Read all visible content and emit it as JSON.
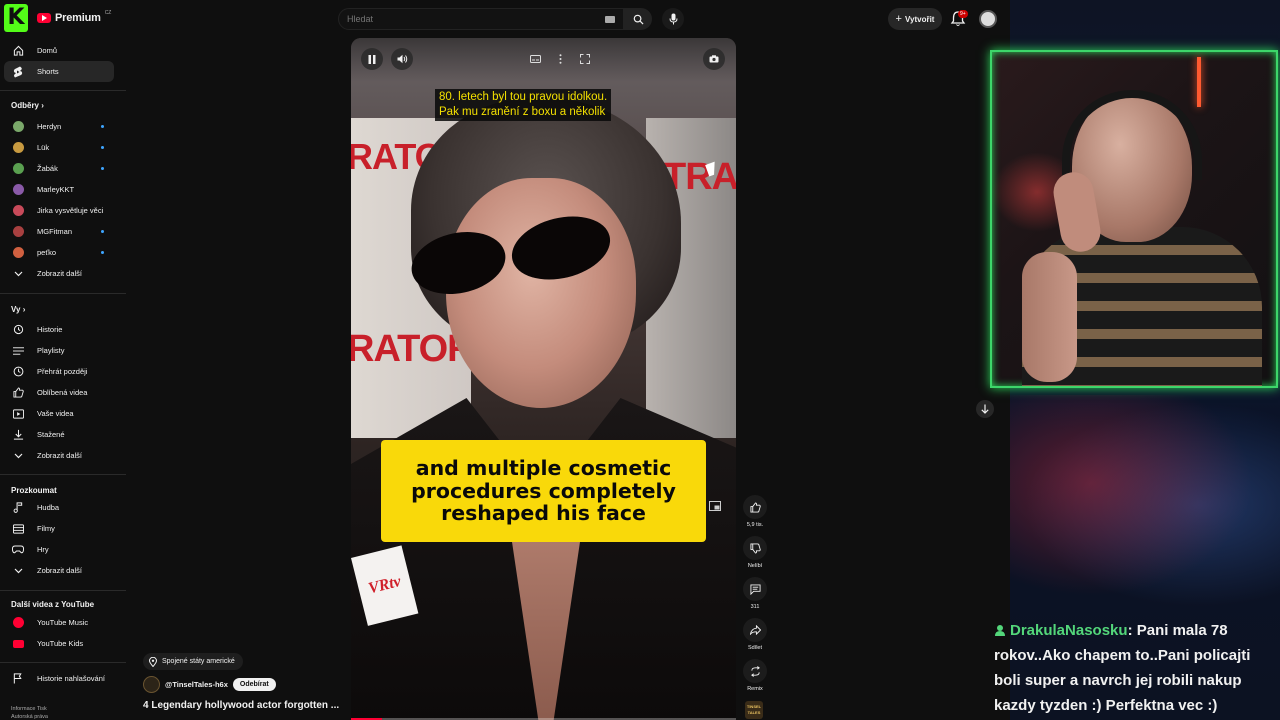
{
  "header": {
    "brand": "Premium",
    "brand_superscript": "CZ",
    "search_placeholder": "Hledat",
    "create_label": "Vytvořit",
    "notification_badge": "9+"
  },
  "sidebar": {
    "home": "Domů",
    "shorts": "Shorts",
    "subscriptions_heading": "Odběry",
    "channels": [
      {
        "name": "Herdyn",
        "color": "#7aa86a"
      },
      {
        "name": "Lük",
        "color": "#c89a40"
      },
      {
        "name": "Žabák",
        "color": "#5aa050"
      },
      {
        "name": "MarleyKKT",
        "color": "#8a5aa8"
      },
      {
        "name": "Jirka vysvětluje věci",
        "color": "#c84a5a"
      },
      {
        "name": "MGFitman",
        "color": "#a84040"
      },
      {
        "name": "peťko",
        "color": "#d06040"
      }
    ],
    "show_more_subs": "Zobrazit další",
    "you_heading": "Vy",
    "you_items": [
      "Historie",
      "Playlisty",
      "Přehrát později",
      "Oblíbená videa",
      "Vaše videa",
      "Stažené",
      "Zobrazit další"
    ],
    "explore_heading": "Prozkoumat",
    "explore_items": [
      "Hudba",
      "Filmy",
      "Hry",
      "Zobrazit další"
    ],
    "more_heading": "Další videa z YouTube",
    "more_items": [
      "YouTube Music",
      "YouTube Kids"
    ],
    "report_history": "Historie nahlašování",
    "footer_1": "Informace  Tisk",
    "footer_2": "Autorská práva"
  },
  "video": {
    "subtitle_line_1": "80. letech byl tou pravou idolkou.",
    "subtitle_line_2": "Pak mu zranění z boxu a několik",
    "caption": "and multiple cosmetic procedures completely reshaped his face",
    "backdrop_text_left_top": "RATOR",
    "backdrop_text_left_bottom": "RATOR",
    "backdrop_text_right": "TRA",
    "mic_logo": "VRtv",
    "progress": 0.08
  },
  "rail": {
    "likes": "5,9 tis.",
    "dislike": "Nelíbí",
    "comments": "311",
    "share": "Sdílet",
    "remix": "Remix",
    "channel_thumb": "TINSEL TALES"
  },
  "info": {
    "location": "Spojené státy americké",
    "channel": "@TinselTales-h6x",
    "subscribe": "Odebírat",
    "title": "4 Legendary hollywood actor forgotten ..."
  },
  "chat": {
    "user": "DrakulaNasosku",
    "message": ": Pani mala 78 rokov..Ako chapem to..Pani policajti boli super a navrch jej robili nakup kazdy tyzden :) Perfektna vec :)"
  },
  "colors": {
    "kick_green": "#53fc18",
    "yt_red": "#ff0033",
    "caption_yellow": "#f9d90a",
    "subtitle_yellow": "#f4e000",
    "webcam_border": "#3dd66a"
  }
}
